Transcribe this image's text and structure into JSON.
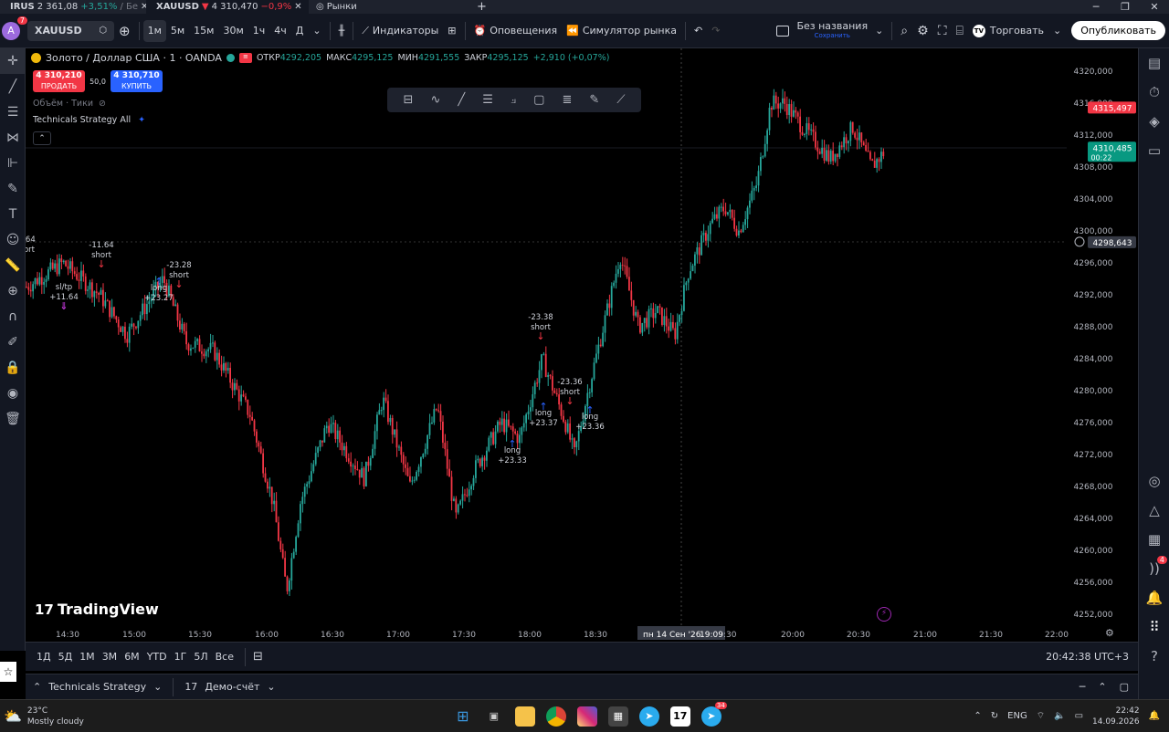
{
  "tabs": [
    {
      "flag": "RU",
      "symbol": "IRUS",
      "price": "2 361,08",
      "change": "+3,51%",
      "tail": "/ Бе",
      "dir": "up"
    },
    {
      "symbol": "XAUUSD",
      "arrow": "▼",
      "price": "4 310,470",
      "change": "−0,9%",
      "dir": "dn"
    },
    {
      "symbol": "Рынки"
    }
  ],
  "toolbar": {
    "avatar": "A",
    "avatar_badge": "7",
    "symbol": "XAUUSD",
    "intervals": [
      "1м",
      "5м",
      "15м",
      "30м",
      "1ч",
      "4ч",
      "Д"
    ],
    "indicators": "Индикаторы",
    "alerts": "Оповещения",
    "simulator": "Симулятор рынка",
    "layout_name": "Без названия",
    "layout_saved": "Сохранить",
    "trade": "Торговать",
    "publish": "Опубликовать"
  },
  "legend": {
    "title": "Золото / Доллар США · 1 · OANDA",
    "open_label": "ОТКР",
    "open": "4292,205",
    "high_label": "МАКС",
    "high": "4295,125",
    "low_label": "МИН",
    "low": "4291,555",
    "close_label": "ЗАКР",
    "close": "4295,125",
    "change": "+2,910 (+0,07%)",
    "sell_price": "4 310,210",
    "sell": "ПРОДАТЬ",
    "spread": "50,0",
    "buy_price": "4 310,710",
    "buy": "КУПИТЬ",
    "volume": "Объём · Тики",
    "strategy": "Technicals Strategy All"
  },
  "price_axis": [
    "4320,000",
    "4316,000",
    "4312,000",
    "4308,000",
    "4304,000",
    "4300,000",
    "4296,000",
    "4292,000",
    "4288,000",
    "4284,000",
    "4280,000",
    "4276,000",
    "4272,000",
    "4268,000",
    "4264,000",
    "4260,000",
    "4256,000",
    "4252,000"
  ],
  "price_tags": {
    "red": "4315,497",
    "green": "4310,485",
    "green_timer": "00:22",
    "crosshair": "4298,643"
  },
  "time_axis": [
    "14:30",
    "15:00",
    "15:30",
    "16:00",
    "16:30",
    "17:00",
    "17:30",
    "18:00",
    "18:30",
    "20:00",
    "20:30",
    "21:00",
    "21:30",
    "22:00"
  ],
  "crosshair_time": {
    "date": "пн 14 Сен '26",
    "time": "19:09",
    "after": ":30"
  },
  "trade_labels": [
    {
      "text": "-11.64",
      "sub": "short"
    },
    {
      "text": "sl/tp",
      "sub": "+11.64"
    },
    {
      "text": "-23.28",
      "sub": "short"
    },
    {
      "text": "long",
      "sub": "+23.27"
    },
    {
      "text": "-23.38",
      "sub": "short"
    },
    {
      "text": "-23.36",
      "sub": "short"
    },
    {
      "text": "long",
      "sub": "+23.37"
    },
    {
      "text": "long",
      "sub": "+23.36"
    },
    {
      "text": "long",
      "sub": "+23.33"
    },
    {
      "text": ".64",
      "sub": "ort"
    }
  ],
  "logo": "TradingView",
  "ranges": [
    "1Д",
    "5Д",
    "1М",
    "3М",
    "6М",
    "YTD",
    "1Г",
    "5Л",
    "Все"
  ],
  "clock": "20:42:38 UTC+3",
  "panel": {
    "strategy": "Technicals Strategy",
    "account": "Демо-счёт"
  },
  "taskbar": {
    "temp": "23°C",
    "weather": "Mostly cloudy",
    "lang": "ENG",
    "time": "22:42",
    "date": "14.09.2026",
    "telegram_badge": "34"
  },
  "right_badge": "4",
  "colors": {
    "up": "#26a69a",
    "down": "#f23645",
    "buy": "#2962ff",
    "bg": "#000000"
  }
}
